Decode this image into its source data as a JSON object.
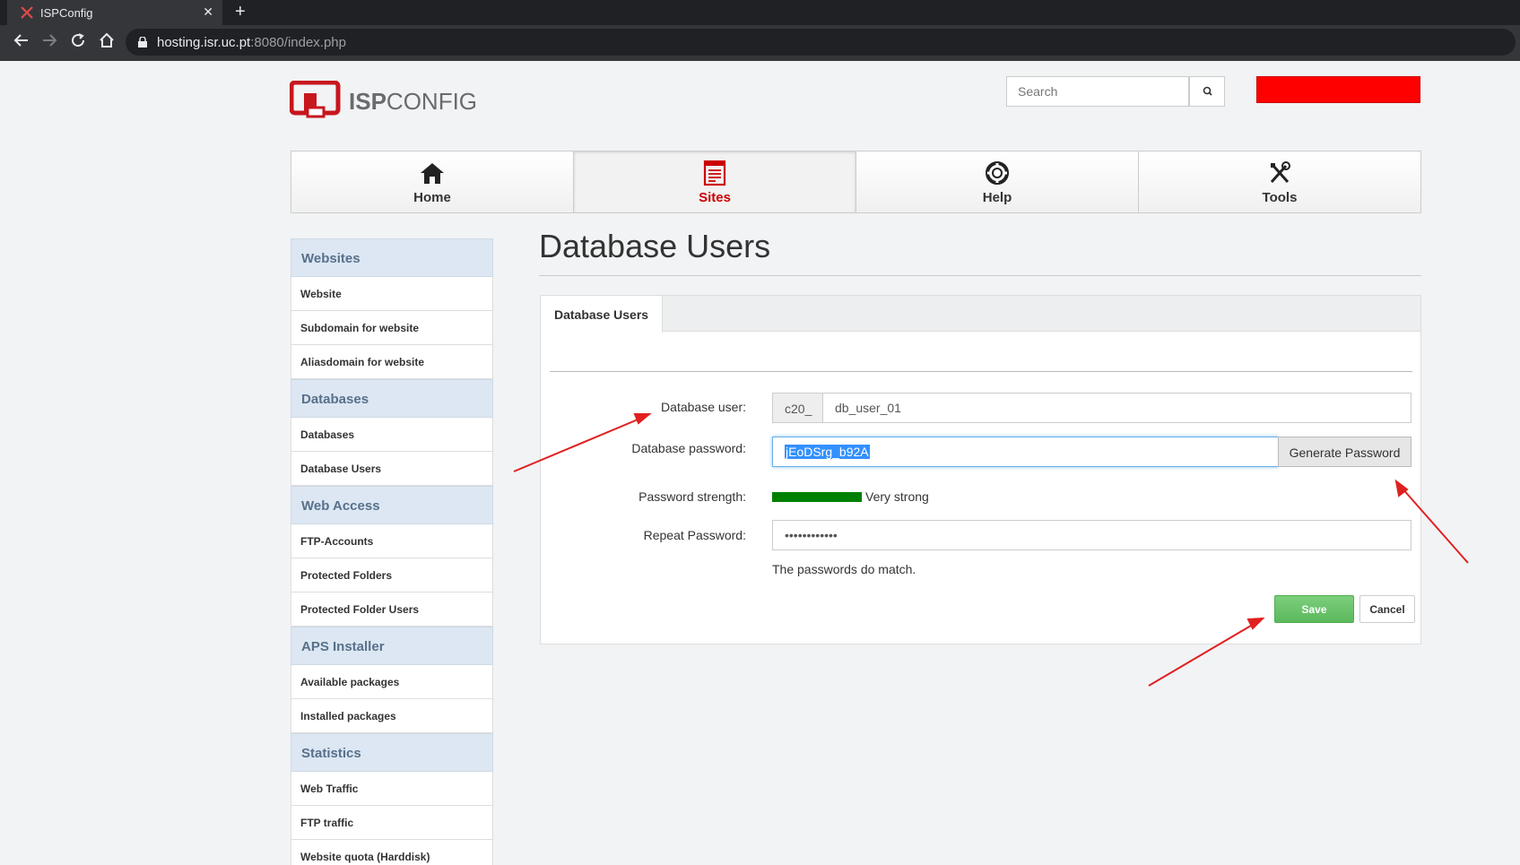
{
  "browser": {
    "tab_title": "ISPConfig",
    "tab_close": "✕",
    "new_tab": "+",
    "url_host": "hosting.isr.uc.pt",
    "url_rest": ":8080/index.php"
  },
  "header": {
    "logo_bold": "ISP",
    "logo_thin": "CONFIG",
    "search_placeholder": "Search"
  },
  "topnav": {
    "items": [
      {
        "label": "Home",
        "icon": "home-icon"
      },
      {
        "label": "Sites",
        "icon": "sites-icon",
        "active": true
      },
      {
        "label": "Help",
        "icon": "help-lifebuoy-icon"
      },
      {
        "label": "Tools",
        "icon": "tools-icon"
      }
    ]
  },
  "sidebar": {
    "sections": [
      {
        "title": "Websites",
        "items": [
          "Website",
          "Subdomain for website",
          "Aliasdomain for website"
        ]
      },
      {
        "title": "Databases",
        "items": [
          "Databases",
          "Database Users"
        ]
      },
      {
        "title": "Web Access",
        "items": [
          "FTP-Accounts",
          "Protected Folders",
          "Protected Folder Users"
        ]
      },
      {
        "title": "APS Installer",
        "items": [
          "Available packages",
          "Installed packages"
        ]
      },
      {
        "title": "Statistics",
        "items": [
          "Web Traffic",
          "FTP traffic",
          "Website quota (Harddisk)"
        ]
      }
    ]
  },
  "main": {
    "title": "Database Users",
    "tab_label": "Database Users",
    "form": {
      "db_user_label": "Database user:",
      "db_user_prefix": "c20_",
      "db_user_value": "db_user_01",
      "db_password_label": "Database password:",
      "db_password_value": "jEoDSrg_b92A",
      "generate_label": "Generate Password",
      "strength_label": "Password strength:",
      "strength_value": "Very strong",
      "strength_fraction": 1.0,
      "repeat_label": "Repeat Password:",
      "repeat_value": "••••••••••••",
      "match_text": "The passwords do match.",
      "save_label": "Save",
      "cancel_label": "Cancel"
    }
  },
  "colors": {
    "accent_red": "#cc0000",
    "strength_green": "#008000",
    "save_green": "#5cb85c",
    "annotation_arrow": "#e02020"
  }
}
